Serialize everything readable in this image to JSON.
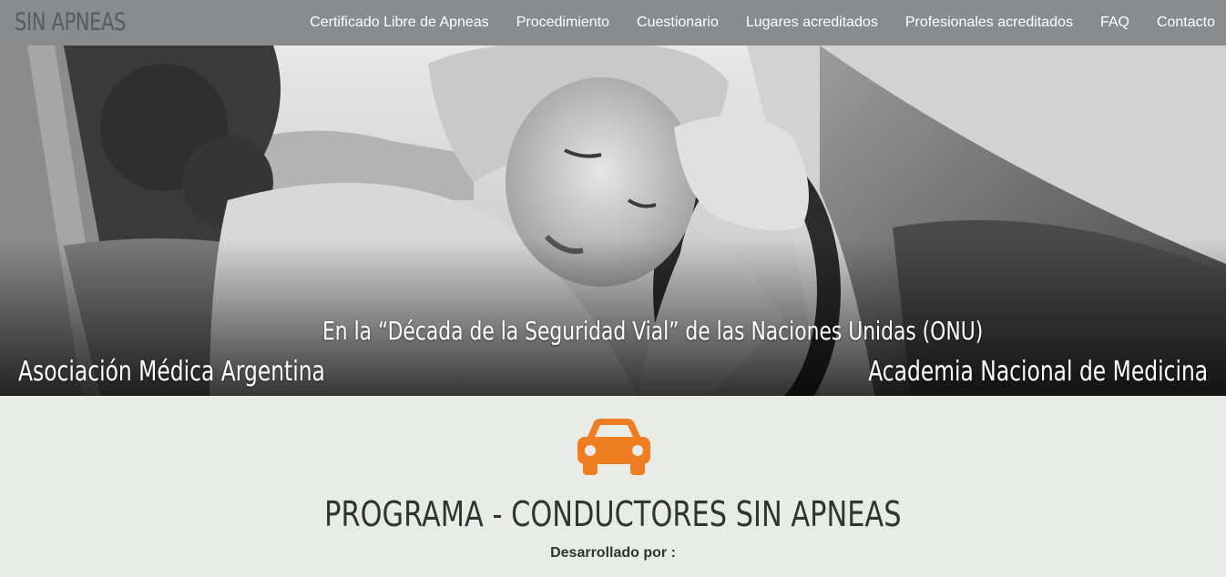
{
  "nav": {
    "brand": "SIN APNEAS",
    "links": [
      "Certificado Libre de Apneas",
      "Procedimiento",
      "Cuestionario",
      "Lugares acreditados",
      "Profesionales acreditados",
      "FAQ",
      "Contacto"
    ]
  },
  "hero": {
    "caption": "En la “Década de la Seguridad Vial” de las Naciones Unidas (ONU)",
    "left_org": "Asociación Médica Argentina",
    "right_org": "Academia Nacional de Medicina"
  },
  "main": {
    "icon": "car-icon",
    "title": "PROGRAMA - CONDUCTORES SIN APNEAS",
    "subtitle": "Desarrollado por :"
  },
  "colors": {
    "navbar": "#8a8b8e",
    "accent": "#ef7d22",
    "page_bg": "#e9ebe6",
    "title_text": "#333333"
  }
}
